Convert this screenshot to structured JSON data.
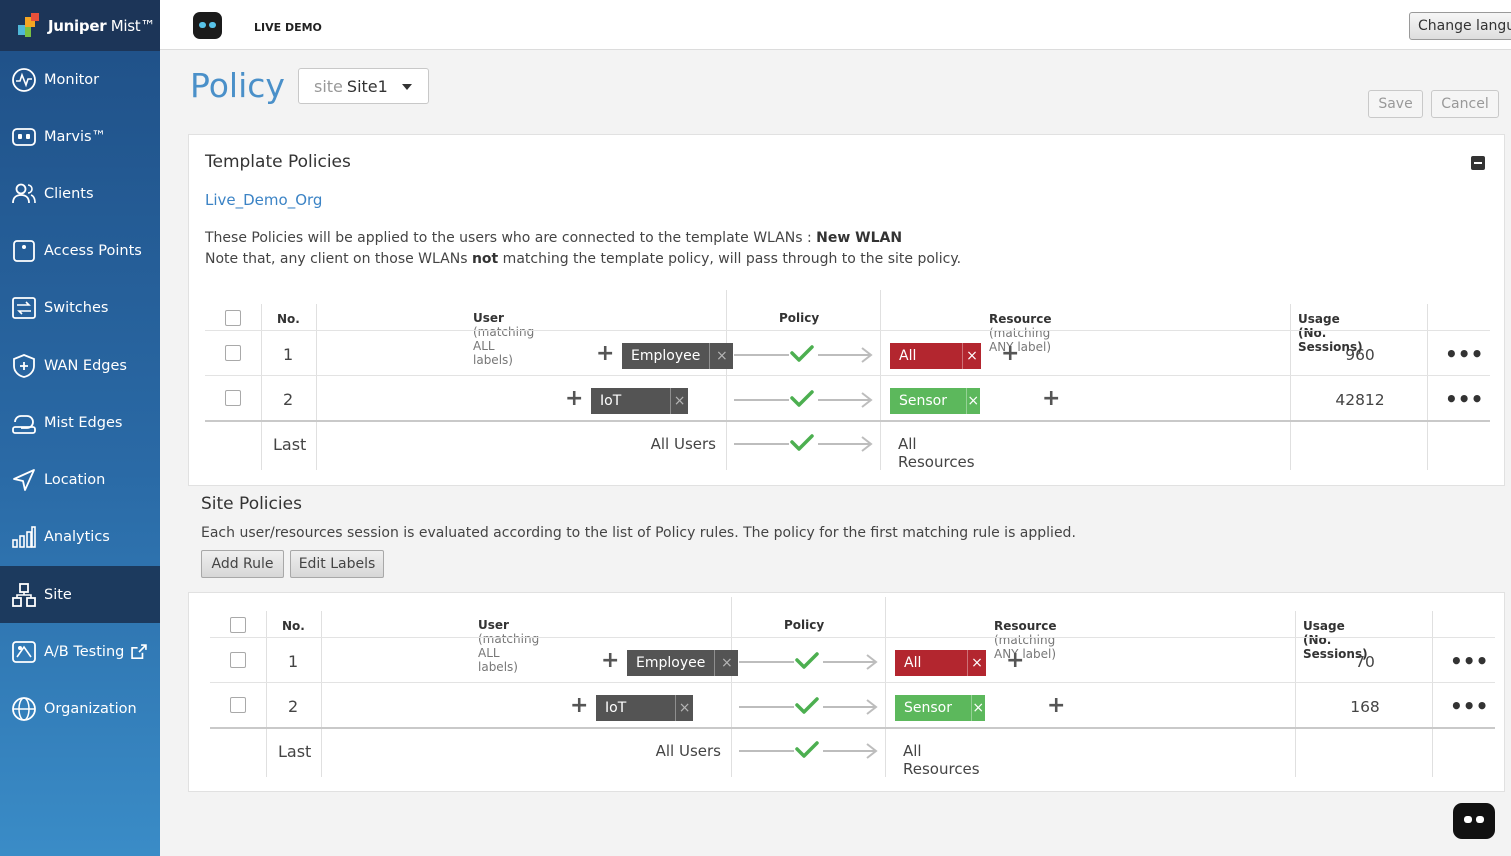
{
  "brand": {
    "name_bold": "Juniper",
    "name_light": " Mist™"
  },
  "sidebar": {
    "items": [
      {
        "label": "Monitor",
        "icon": "monitor-icon"
      },
      {
        "label": "Marvis™",
        "icon": "marvis-icon"
      },
      {
        "label": "Clients",
        "icon": "clients-icon"
      },
      {
        "label": "Access Points",
        "icon": "access-points-icon"
      },
      {
        "label": "Switches",
        "icon": "switches-icon"
      },
      {
        "label": "WAN Edges",
        "icon": "wan-edges-icon"
      },
      {
        "label": "Mist Edges",
        "icon": "mist-edges-icon"
      },
      {
        "label": "Location",
        "icon": "location-icon"
      },
      {
        "label": "Analytics",
        "icon": "analytics-icon"
      },
      {
        "label": "Site",
        "icon": "site-icon",
        "active": true
      },
      {
        "label": "A/B Testing",
        "icon": "ab-testing-icon"
      },
      {
        "label": "Organization",
        "icon": "organization-icon"
      }
    ]
  },
  "topbar": {
    "live_demo": "LIVE DEMO",
    "change_language": "Change langu"
  },
  "page": {
    "title": "Policy",
    "site_label": "site",
    "site_value": "Site1",
    "save": "Save",
    "cancel": "Cancel"
  },
  "template": {
    "title": "Template Policies",
    "org_link": "Live_Demo_Org",
    "desc1_pre": "These Policies will be applied to the users who are connected to the template WLANs : ",
    "desc1_wlan": "New WLAN",
    "desc2_pre": "Note that, any client on those WLANs ",
    "desc2_bold": "not",
    "desc2_post": " matching the template policy, will pass through to the site policy.",
    "rows": [
      {
        "no": "1",
        "user_tag": "Employee",
        "resource_tag": "All Socials",
        "resource_color": "#b3262f",
        "usage": "960"
      },
      {
        "no": "2",
        "user_tag": "IoT Sensors",
        "resource_tag": "Sensor Server",
        "resource_color": "#5cb85c",
        "usage": "42812"
      }
    ],
    "last": {
      "no": "Last",
      "user": "All Users",
      "resource": "All Resources"
    }
  },
  "table_headers": {
    "no": "No.",
    "user": "User",
    "user_note": " (matching ALL labels)",
    "policy": "Policy",
    "resource": "Resource",
    "resource_note": " (matching ANY label)",
    "usage": "Usage (No. Sessions)"
  },
  "site": {
    "title": "Site Policies",
    "desc": "Each user/resources session is evaluated according to the list of Policy rules. The policy for the first matching rule is applied.",
    "add_rule": "Add Rule",
    "edit_labels": "Edit Labels",
    "rows": [
      {
        "no": "1",
        "user_tag": "Employee",
        "resource_tag": "All Socials",
        "resource_color": "#b3262f",
        "usage": "70"
      },
      {
        "no": "2",
        "user_tag": "IoT Sensors",
        "resource_tag": "Sensor Server",
        "resource_color": "#5cb85c",
        "usage": "168"
      }
    ],
    "last": {
      "no": "Last",
      "user": "All Users",
      "resource": "All Resources"
    }
  },
  "glyphs": {
    "plus": "+",
    "close": "×",
    "more": "•••"
  },
  "colors": {
    "accent": "#4a90c9",
    "check": "#4caf50",
    "sidebar": "#2a6aa6"
  }
}
